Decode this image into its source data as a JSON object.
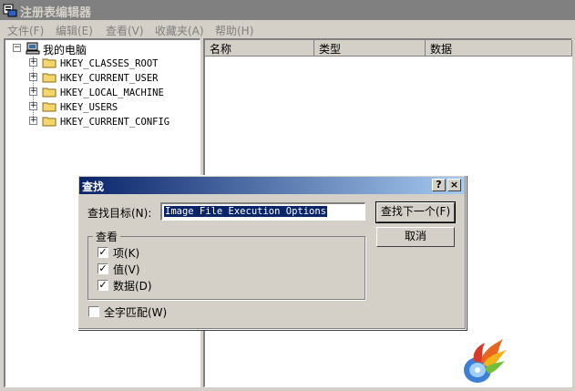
{
  "window": {
    "title": "注册表编辑器"
  },
  "menu": [
    {
      "label": "文件(F)"
    },
    {
      "label": "编辑(E)"
    },
    {
      "label": "查看(V)"
    },
    {
      "label": "收藏夹(A)"
    },
    {
      "label": "帮助(H)"
    }
  ],
  "tree": {
    "root": "我的电脑",
    "root_expander": "−",
    "children": [
      {
        "label": "HKEY_CLASSES_ROOT",
        "expander": "+"
      },
      {
        "label": "HKEY_CURRENT_USER",
        "expander": "+"
      },
      {
        "label": "HKEY_LOCAL_MACHINE",
        "expander": "+"
      },
      {
        "label": "HKEY_USERS",
        "expander": "+"
      },
      {
        "label": "HKEY_CURRENT_CONFIG",
        "expander": "+"
      }
    ]
  },
  "list": {
    "columns": [
      "名称",
      "类型",
      "数据"
    ]
  },
  "find_dialog": {
    "title": "查找",
    "help_btn": "?",
    "close_btn": "×",
    "target_label": "查找目标(N):",
    "target_value": "Image File Execution Options",
    "find_next_label": "查找下一个(F)",
    "cancel_label": "取消",
    "look_at_label": "查看",
    "options": [
      {
        "label": "项(K)",
        "checked": true
      },
      {
        "label": "值(V)",
        "checked": true
      },
      {
        "label": "数据(D)",
        "checked": true
      }
    ],
    "whole_word_label": "全字匹配(W)",
    "whole_word_checked": false,
    "check_mark": "✓"
  },
  "colors": {
    "selection": "#0a246a",
    "face": "#d4d0c8",
    "shadow": "#808080"
  },
  "icons": {
    "app": "regedit-icon",
    "computer": "computer-icon",
    "folder": "folder-icon",
    "logo": "flame-disc-logo"
  }
}
